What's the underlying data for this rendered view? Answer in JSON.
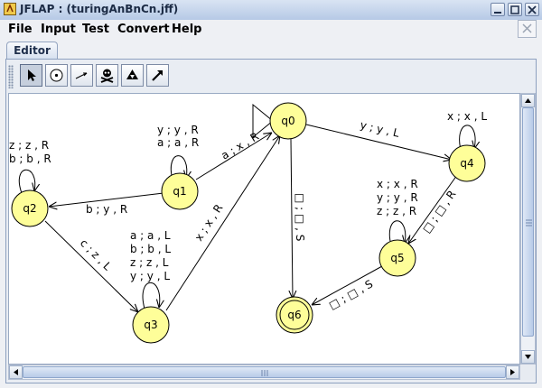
{
  "window": {
    "title": "JFLAP : (turingAnBnCn.jff)"
  },
  "menu": {
    "items": [
      "File",
      "Input",
      "Test",
      "Convert",
      "Help"
    ]
  },
  "tabs": [
    {
      "label": "Editor"
    }
  ],
  "toolbar": {
    "tools": [
      {
        "icon": "pointer-arrow-icon",
        "selected": true
      },
      {
        "icon": "state-creator-icon"
      },
      {
        "icon": "transition-creator-icon"
      },
      {
        "icon": "skull-delete-icon"
      },
      {
        "icon": "undo-triangles-icon"
      },
      {
        "icon": "redo-arrow-icon"
      }
    ]
  },
  "automaton": {
    "states": [
      {
        "id": "q0",
        "label": "q0",
        "initial": true
      },
      {
        "id": "q1",
        "label": "q1"
      },
      {
        "id": "q2",
        "label": "q2"
      },
      {
        "id": "q3",
        "label": "q3"
      },
      {
        "id": "q4",
        "label": "q4"
      },
      {
        "id": "q5",
        "label": "q5"
      },
      {
        "id": "q6",
        "label": "q6",
        "final": true
      }
    ],
    "transitions": [
      {
        "from": "q0",
        "to": "q4",
        "labels": [
          "y ; y , L"
        ]
      },
      {
        "from": "q1",
        "to": "q0",
        "labels": [
          "a ; x , R"
        ]
      },
      {
        "from": "q1",
        "to": "q2",
        "labels": [
          "b ; y , R"
        ]
      },
      {
        "from": "q1",
        "to": "q1",
        "labels": [
          "y ; y , R",
          "a ; a , R"
        ]
      },
      {
        "from": "q2",
        "to": "q2",
        "labels": [
          "z ; z , R",
          "b ; b , R"
        ]
      },
      {
        "from": "q2",
        "to": "q3",
        "labels": [
          "c ; z , L"
        ]
      },
      {
        "from": "q3",
        "to": "q3",
        "labels": [
          "a ; a , L",
          "b ; b , L",
          "z ; z , L",
          "y ; y , L"
        ]
      },
      {
        "from": "q3",
        "to": "q0",
        "labels": [
          "x ; x , R"
        ]
      },
      {
        "from": "q0",
        "to": "q6",
        "labels": [
          "□ ; □ , S"
        ]
      },
      {
        "from": "q4",
        "to": "q4",
        "labels": [
          "x ; x , L"
        ]
      },
      {
        "from": "q4",
        "to": "q5",
        "labels": [
          "□ ; □ , R"
        ]
      },
      {
        "from": "q5",
        "to": "q5",
        "labels": [
          "x ; x , R",
          "y ; y , R",
          "z ; z , R"
        ]
      },
      {
        "from": "q5",
        "to": "q6",
        "labels": [
          "□ ; □ , S"
        ]
      }
    ]
  },
  "colors": {
    "state_fill": "#fefe99",
    "canvas_bg": "#ffffff"
  }
}
